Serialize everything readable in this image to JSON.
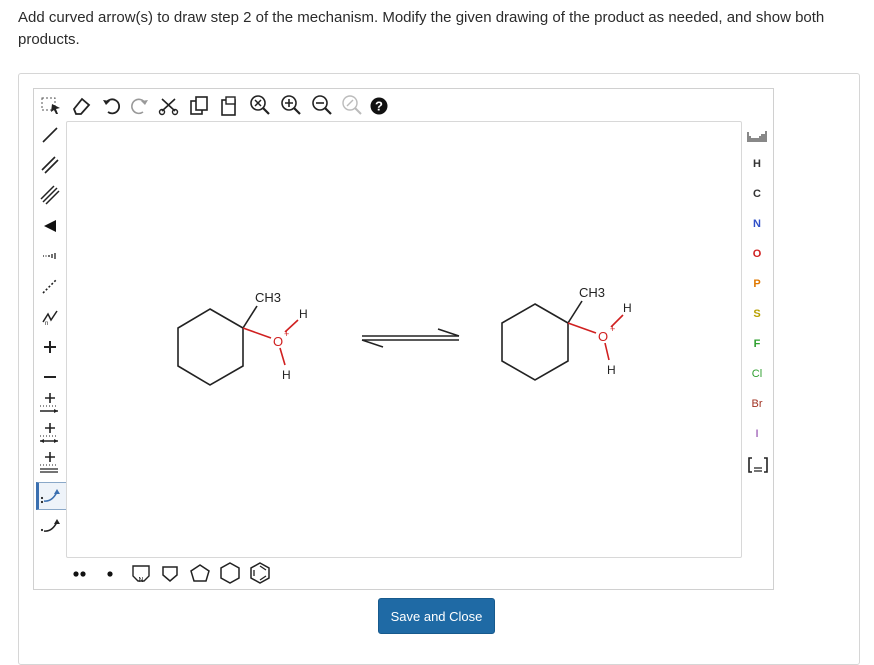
{
  "prompt": "Add curved arrow(s) to draw step 2 of the mechanism. Modify the given drawing of the product as needed, and show both products.",
  "toolbar": {
    "top_tools": [
      "marquee-select-icon",
      "eraser-icon",
      "undo-icon",
      "redo-icon",
      "cut-icon",
      "copy-icon",
      "paste-icon",
      "zoom-fit-icon",
      "zoom-in-icon",
      "zoom-out-icon",
      "clean-icon",
      "help-icon"
    ],
    "left_tools": [
      "single-bond-icon",
      "double-bond-icon",
      "triple-bond-icon",
      "wedge-bond-icon",
      "hash-bond-icon",
      "dashed-bond-icon",
      "chain-icon",
      "plus-charge-icon",
      "minus-charge-icon",
      "electron-arrow-1-icon",
      "electron-arrow-2-icon",
      "electron-arrow-3-icon",
      "curved-arrow-pair-icon",
      "curved-arrow-single-icon"
    ],
    "bottom_tools": [
      "lone-pair-icon",
      "radical-icon",
      "heterocycle-icon",
      "cyclobutane-icon",
      "cyclopentane-icon",
      "cyclohexane-icon",
      "benzene-icon"
    ]
  },
  "elements": {
    "periodic_table": "periodic-table-icon",
    "symbols": [
      "H",
      "C",
      "N",
      "O",
      "P",
      "S",
      "F",
      "Cl",
      "Br",
      "I"
    ],
    "bracket": "bracket-icon"
  },
  "reactant": {
    "methyl": "CH3",
    "oxonium_o": "O",
    "charge": "+",
    "h_top": "H",
    "h_bottom": "H"
  },
  "product": {
    "methyl": "CH3",
    "oxonium_o": "O",
    "charge": "+",
    "h_top": "H",
    "h_bottom": "H"
  },
  "colors": {
    "oxygen": "#d02020",
    "button": "#1f6aa5"
  },
  "save_button": "Save and Close"
}
